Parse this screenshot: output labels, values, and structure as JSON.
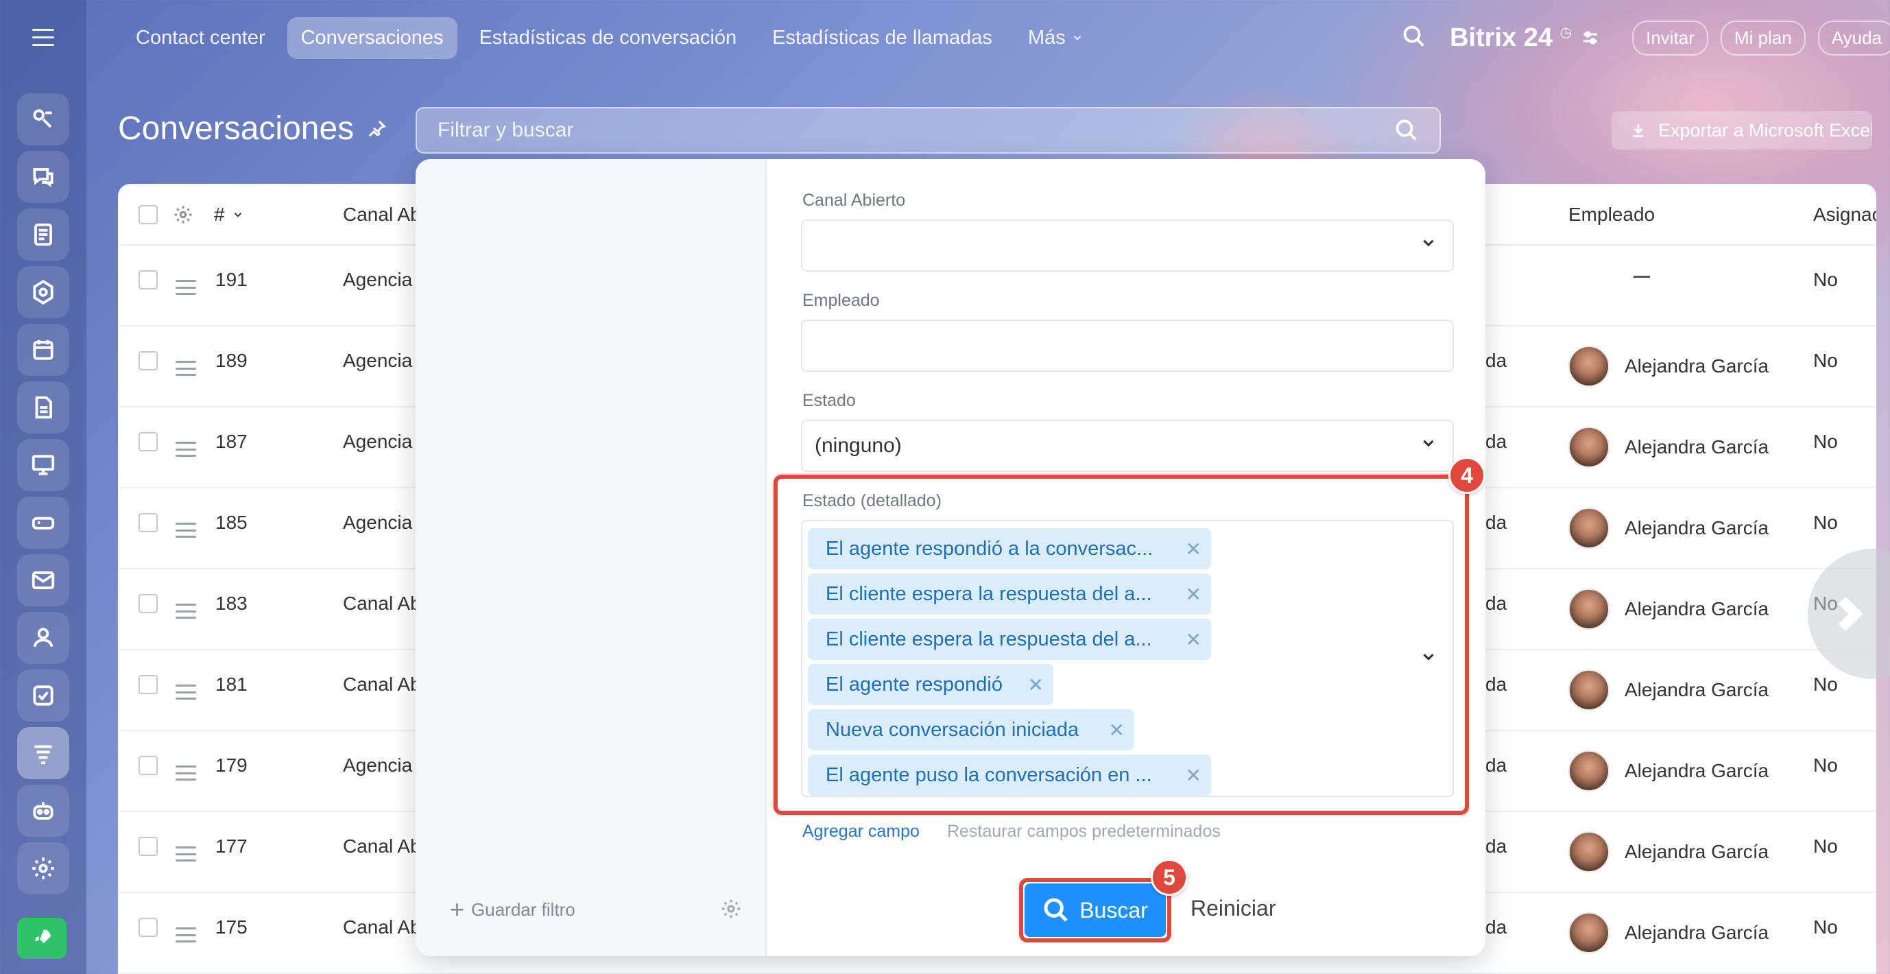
{
  "nav": {
    "items": [
      "Contact center",
      "Conversaciones",
      "Estadísticas de conversación",
      "Estadísticas de llamadas"
    ],
    "more": "Más",
    "active_index": 1
  },
  "header": {
    "brand": "Bitrix 24",
    "invite": "Invitar",
    "plan": "Mi plan",
    "help": "Ayuda"
  },
  "page": {
    "title": "Conversaciones",
    "filter_placeholder": "Filtrar y buscar",
    "export": "Exportar a Microsoft Excel"
  },
  "table": {
    "columns": {
      "num": "#",
      "channel": "Canal Ab",
      "employee": "Empleado",
      "assigned": "Asignac"
    },
    "rows": [
      {
        "id": "191",
        "channel": "Agencia",
        "status": "",
        "employee": "",
        "assigned": "No"
      },
      {
        "id": "189",
        "channel": "Agencia",
        "status": "da",
        "employee": "Alejandra García",
        "assigned": "No"
      },
      {
        "id": "187",
        "channel": "Agencia",
        "status": "da",
        "employee": "Alejandra García",
        "assigned": "No"
      },
      {
        "id": "185",
        "channel": "Agencia",
        "status": "da",
        "employee": "Alejandra García",
        "assigned": "No"
      },
      {
        "id": "183",
        "channel": "Canal Ab",
        "status": "da",
        "employee": "Alejandra García",
        "assigned": "No"
      },
      {
        "id": "181",
        "channel": "Canal Ab",
        "status": "da",
        "employee": "Alejandra García",
        "assigned": "No"
      },
      {
        "id": "179",
        "channel": "Agencia",
        "status": "da",
        "employee": "Alejandra García",
        "assigned": "No"
      },
      {
        "id": "177",
        "channel": "Canal Ab",
        "status": "da",
        "employee": "Alejandra García",
        "assigned": "No"
      },
      {
        "id": "175",
        "channel": "Canal Ab",
        "status": "da",
        "employee": "Alejandra García",
        "assigned": "No"
      }
    ]
  },
  "filter": {
    "save_filter": "Guardar filtro",
    "fields": {
      "open_channel": {
        "label": "Canal Abierto",
        "value": ""
      },
      "employee": {
        "label": "Empleado",
        "value": ""
      },
      "status": {
        "label": "Estado",
        "value": "(ninguno)"
      },
      "status_detailed": {
        "label": "Estado (detallado)",
        "tags": [
          "El agente respondió a la conversac...",
          "El cliente espera la respuesta del a...",
          "El cliente espera la respuesta del a...",
          "El agente respondió",
          "Nueva conversación iniciada",
          "El agente puso la conversación en ..."
        ]
      }
    },
    "add_field": "Agregar campo",
    "restore_fields": "Restaurar campos predeterminados",
    "search": "Buscar",
    "reset": "Reiniciar",
    "badge_fields": "4",
    "badge_search": "5"
  },
  "colors": {
    "accent": "#1e90ff",
    "highlight": "#e0483e",
    "tag_bg": "#dbecfb",
    "tag_text": "#1f6fb5"
  }
}
